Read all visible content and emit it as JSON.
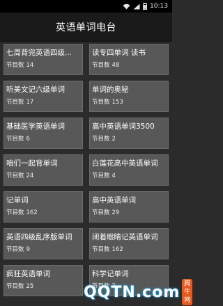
{
  "status_bar": {
    "time": "10:13",
    "icons": [
      "wifi-icon",
      "signal-icon",
      "battery-icon"
    ]
  },
  "app_bar": {
    "title": "英语单词电台"
  },
  "count_label": "节目数",
  "channels": [
    {
      "name": "七周背完英语四级...",
      "count": "14"
    },
    {
      "name": "读专四单词 读书",
      "count": "48"
    },
    {
      "name": "听美文记六级单词",
      "count": "17"
    },
    {
      "name": "单词的奥秘",
      "count": "153"
    },
    {
      "name": "基础医学英语单词",
      "count": "6"
    },
    {
      "name": "高中英语单词3500",
      "count": "2"
    },
    {
      "name": "咱们一起背单词",
      "count": "24"
    },
    {
      "name": "白莲花高中英语单词",
      "count": "4"
    },
    {
      "name": "记单词",
      "count": "162"
    },
    {
      "name": "高中英语单词",
      "count": "29"
    },
    {
      "name": "英语四级乱序版单词",
      "count": "9"
    },
    {
      "name": "闭着眼睛记英语单词",
      "count": "162"
    },
    {
      "name": "疯狂英语单词",
      "count": "25"
    },
    {
      "name": "科学记单词",
      "count": "7"
    }
  ],
  "watermark": {
    "text": "QQTN.com",
    "badge": "腾牛网"
  }
}
